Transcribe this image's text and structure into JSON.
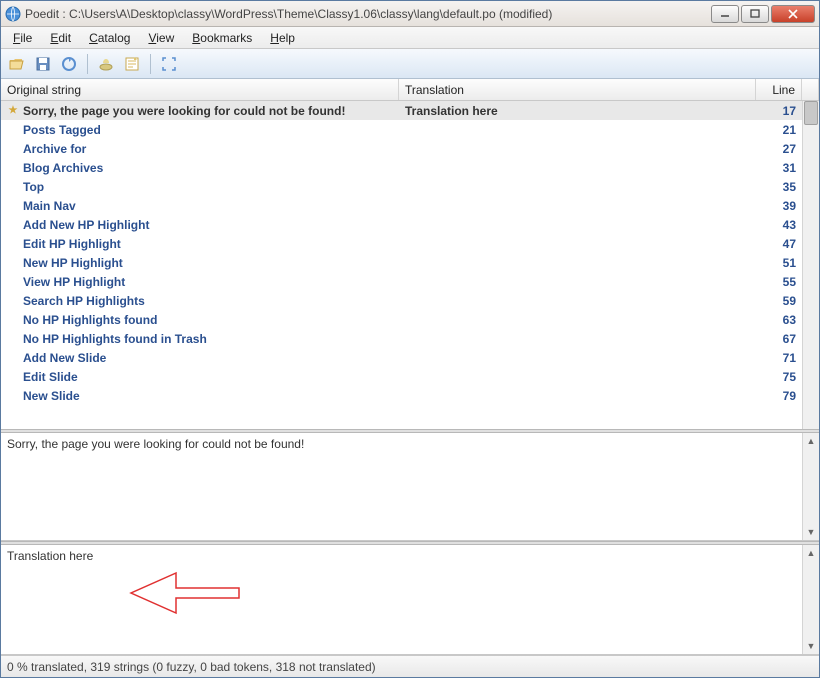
{
  "title": "Poedit : C:\\Users\\A\\Desktop\\classy\\WordPress\\Theme\\Classy1.06\\classy\\lang\\default.po (modified)",
  "menus": {
    "file": "File",
    "edit": "Edit",
    "catalog": "Catalog",
    "view": "View",
    "bookmarks": "Bookmarks",
    "help": "Help"
  },
  "columns": {
    "original": "Original string",
    "translation": "Translation",
    "line": "Line"
  },
  "rows": [
    {
      "orig": "Sorry, the page you were looking for could not be found!",
      "trans": "Translation here",
      "line": "17",
      "selected": true,
      "starred": true
    },
    {
      "orig": "Posts Tagged",
      "trans": "",
      "line": "21"
    },
    {
      "orig": "Archive for",
      "trans": "",
      "line": "27"
    },
    {
      "orig": "Blog Archives",
      "trans": "",
      "line": "31"
    },
    {
      "orig": "Top",
      "trans": "",
      "line": "35"
    },
    {
      "orig": "Main Nav",
      "trans": "",
      "line": "39"
    },
    {
      "orig": "Add New HP Highlight",
      "trans": "",
      "line": "43"
    },
    {
      "orig": "Edit HP Highlight",
      "trans": "",
      "line": "47"
    },
    {
      "orig": "New HP Highlight",
      "trans": "",
      "line": "51"
    },
    {
      "orig": "View HP Highlight",
      "trans": "",
      "line": "55"
    },
    {
      "orig": "Search HP Highlights",
      "trans": "",
      "line": "59"
    },
    {
      "orig": "No HP Highlights found",
      "trans": "",
      "line": "63"
    },
    {
      "orig": "No HP Highlights found in Trash",
      "trans": "",
      "line": "67"
    },
    {
      "orig": "Add New Slide",
      "trans": "",
      "line": "71"
    },
    {
      "orig": "Edit Slide",
      "trans": "",
      "line": "75"
    },
    {
      "orig": "New Slide",
      "trans": "",
      "line": "79"
    }
  ],
  "source_text": "Sorry, the page you were looking for could not be found!",
  "target_text": "Translation here",
  "status": "0 % translated, 319 strings (0 fuzzy, 0 bad tokens, 318 not translated)"
}
